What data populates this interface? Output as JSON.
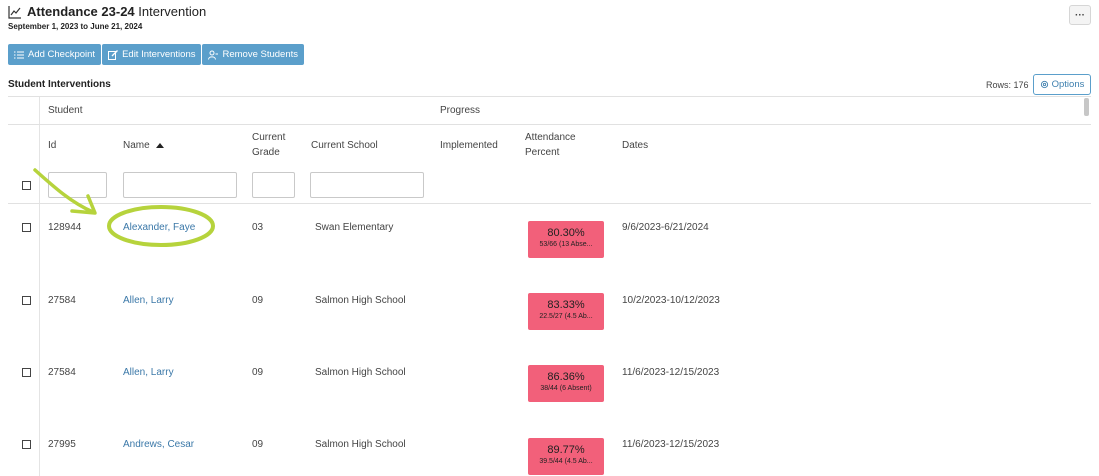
{
  "header": {
    "title_bold": "Attendance 23-24",
    "title_rest": " Intervention",
    "date_range": "September 1, 2023 to June 21, 2024",
    "more_label": "···"
  },
  "toolbar": {
    "add_checkpoint": "Add Checkpoint",
    "edit_interventions": "Edit Interventions",
    "remove_students": "Remove Students"
  },
  "section": {
    "title": "Student Interventions",
    "rows_label": "Rows: 176",
    "options_label": "Options"
  },
  "table": {
    "groups": {
      "student": "Student",
      "progress": "Progress"
    },
    "columns": {
      "id": "Id",
      "name": "Name",
      "grade_line1": "Current",
      "grade_line2": "Grade",
      "school": "Current School",
      "implemented": "Implemented",
      "attendance_line1": "Attendance",
      "attendance_line2": "Percent",
      "dates": "Dates"
    },
    "rows": [
      {
        "id": "128944",
        "name": "Alexander, Faye",
        "grade": "03",
        "school": "Swan Elementary",
        "percent": "80.30%",
        "detail": "53/66 (13 Abse...",
        "dates": "9/6/2023-6/21/2024"
      },
      {
        "id": "27584",
        "name": "Allen, Larry",
        "grade": "09",
        "school": "Salmon High School",
        "percent": "83.33%",
        "detail": "22.5/27 (4.5 Ab...",
        "dates": "10/2/2023-10/12/2023"
      },
      {
        "id": "27584",
        "name": "Allen, Larry",
        "grade": "09",
        "school": "Salmon High School",
        "percent": "86.36%",
        "detail": "38/44 (6 Absent)",
        "dates": "11/6/2023-12/15/2023"
      },
      {
        "id": "27995",
        "name": "Andrews, Cesar",
        "grade": "09",
        "school": "Salmon High School",
        "percent": "89.77%",
        "detail": "39.5/44 (4.5 Ab...",
        "dates": "11/6/2023-12/15/2023"
      }
    ]
  },
  "colors": {
    "button_blue": "#5b9fcb",
    "badge_red": "#f2607a",
    "link_blue": "#3b78a8",
    "annotation_green": "#b6d33c"
  }
}
